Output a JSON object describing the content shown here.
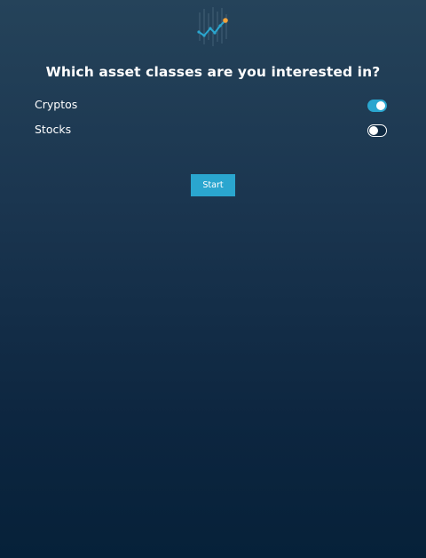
{
  "logo": {
    "icon": "trend-chart-icon",
    "accent_color": "#2aa6cf",
    "dot_color": "#f5a23a"
  },
  "question": "Which asset classes are you interested in?",
  "options": [
    {
      "label": "Cryptos",
      "enabled": true
    },
    {
      "label": "Stocks",
      "enabled": false
    }
  ],
  "start_button": {
    "label": "Start"
  },
  "colors": {
    "accent": "#2aa6cf",
    "background_top": "#25435a",
    "background_bottom": "#062139"
  }
}
